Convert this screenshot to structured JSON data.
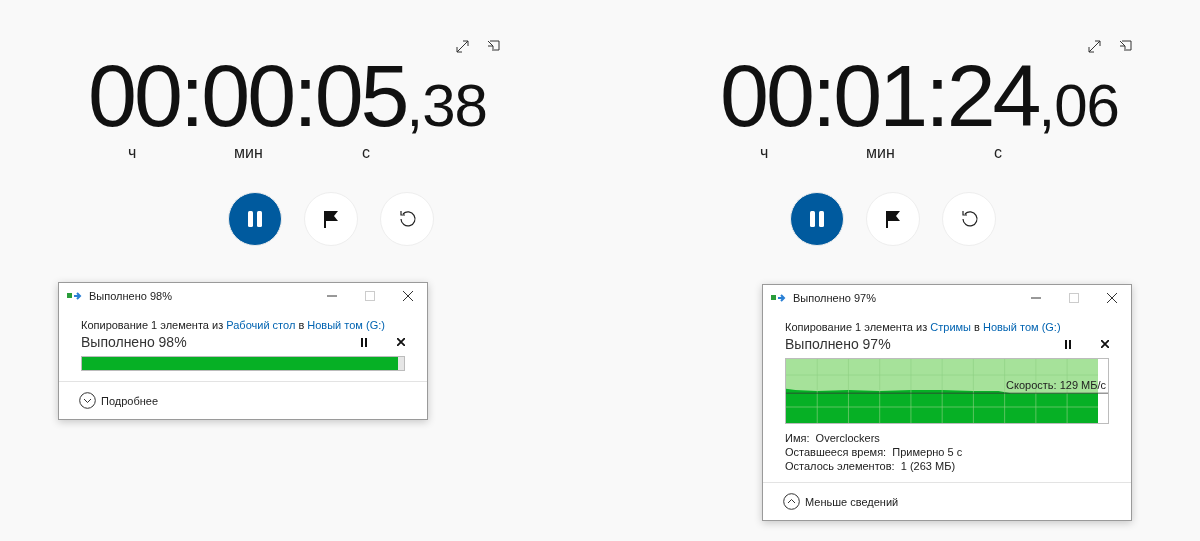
{
  "panels": [
    {
      "time": "00:00:05",
      "fraction": ",38",
      "units": [
        "ч",
        "мин",
        "с"
      ],
      "running": true,
      "dialog": {
        "title": "Выполнено 98%",
        "copy_prefix": "Копирование 1 элемента из",
        "source": "Рабочий стол",
        "joiner": "в",
        "destination": "Новый том (G:)",
        "status": "Выполнено 98%",
        "kind": "bar",
        "level": 0.98,
        "toggle": {
          "label": "Подробнее",
          "expanded": false
        }
      }
    },
    {
      "time": "00:01:24",
      "fraction": ",06",
      "units": [
        "ч",
        "мин",
        "с"
      ],
      "running": true,
      "dialog": {
        "title": "Выполнено 97%",
        "copy_prefix": "Копирование 1 элемента из",
        "source": "Стримы",
        "joiner": "в",
        "destination": "Новый том (G:)",
        "status": "Выполнено 97%",
        "kind": "graph",
        "level": 0.97,
        "speed": "Скорость: 129 МБ/с",
        "details": [
          {
            "label": "Имя:",
            "value": "Overclockers"
          },
          {
            "label": "Оставшееся время:",
            "value": "Примерно 5 с"
          },
          {
            "label": "Осталось элементов:",
            "value": "1 (263 МБ)"
          }
        ],
        "toggle": {
          "label": "Меньше сведений",
          "expanded": true
        }
      }
    }
  ]
}
